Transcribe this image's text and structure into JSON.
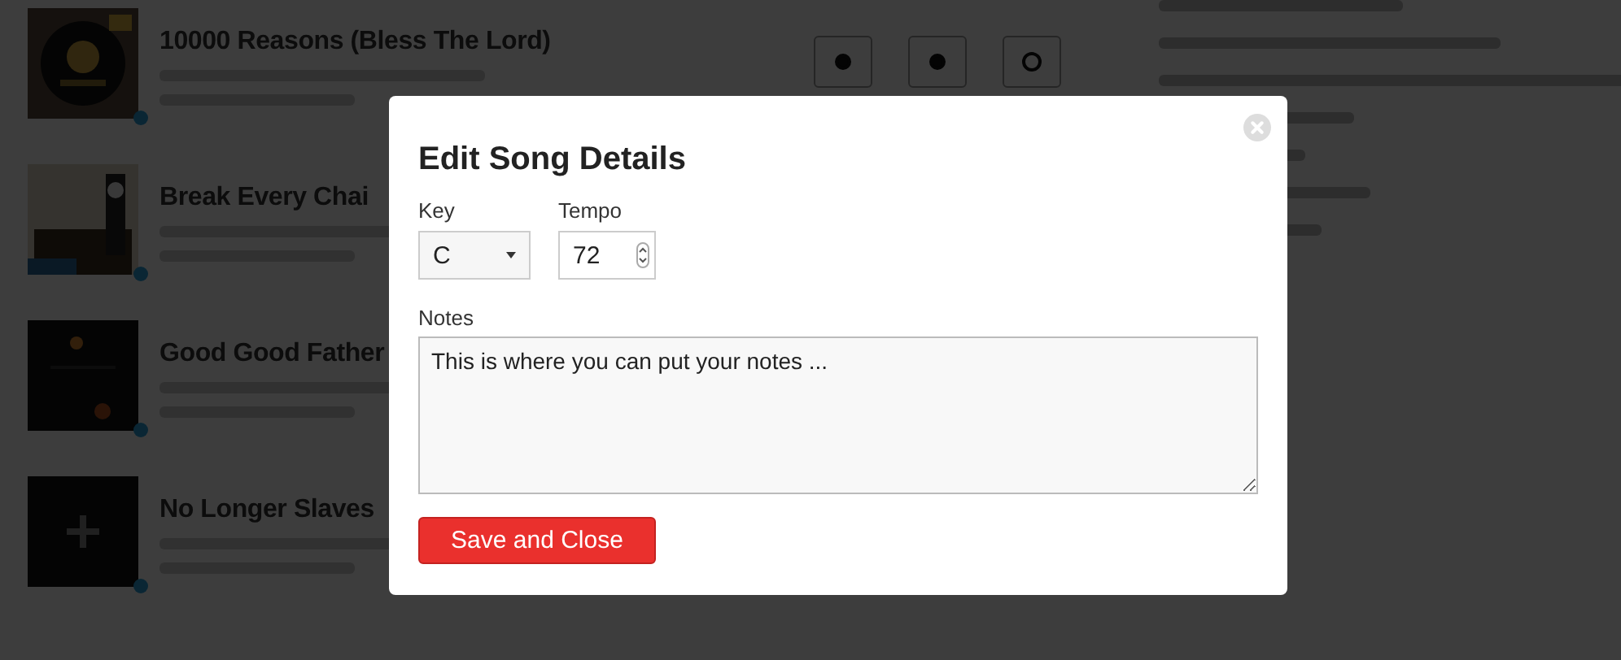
{
  "songs": [
    {
      "title": "10000 Reasons (Bless The Lord)"
    },
    {
      "title": "Break Every Chai"
    },
    {
      "title": "Good Good Father"
    },
    {
      "title": "No Longer Slaves"
    }
  ],
  "modal": {
    "title": "Edit Song Details",
    "key": {
      "label": "Key",
      "value": "C"
    },
    "tempo": {
      "label": "Tempo",
      "value": "72"
    },
    "notes": {
      "label": "Notes",
      "value": "This is where you can put your notes ..."
    },
    "button": "Save and Close"
  }
}
